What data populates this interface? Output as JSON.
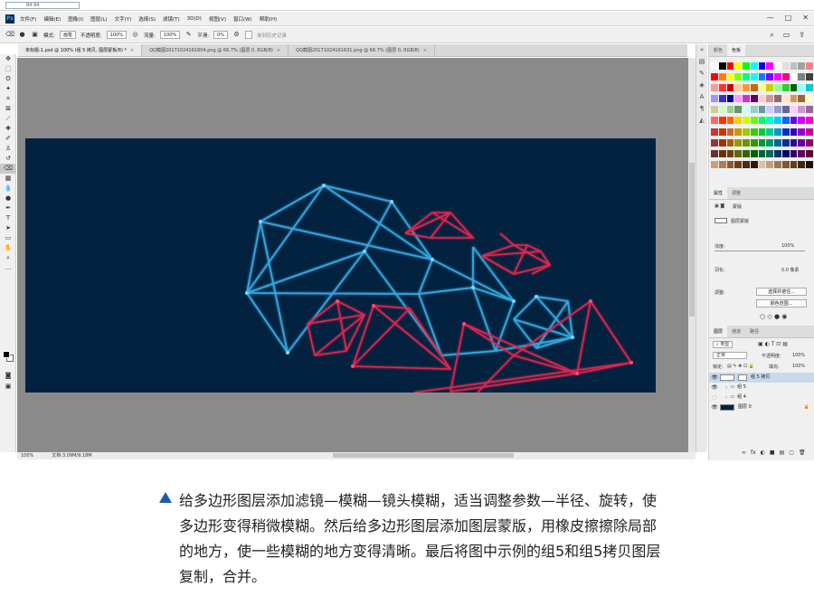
{
  "browser_strip": {
    "address_text": "84.94"
  },
  "menu": {
    "items": [
      "文件(F)",
      "编辑(E)",
      "图像(I)",
      "图层(L)",
      "文字(Y)",
      "选择(S)",
      "滤镜(T)",
      "3D(D)",
      "视图(V)",
      "窗口(W)",
      "帮助(H)"
    ],
    "window_controls": [
      "—",
      "□",
      "✕"
    ]
  },
  "options": {
    "mode_label": "模式:",
    "mode_value": "画笔",
    "opacity_label": "不透明度:",
    "opacity_value": "100%",
    "flow_label": "流量:",
    "flow_value": "100%",
    "smooth_label": "平滑:",
    "smooth_value": "0%",
    "history_label": "抹到历史记录"
  },
  "tabs": [
    {
      "label": "未标题-1.psd @ 100% (组 5 拷贝, 图层蒙板/8) *",
      "close": "×"
    },
    {
      "label": "QQ截图20171024161604.png @ 66.7% (图层 0, RGB/8)",
      "close": "×"
    },
    {
      "label": "QQ截图20171024161631.png @ 66.7% (图层 0, RGB/8)",
      "close": "×"
    }
  ],
  "status": {
    "zoom": "100%",
    "doc": "文档:3.09M/9.18M"
  },
  "swatches_panel": {
    "tabs": [
      "颜色",
      "色板"
    ],
    "colors": [
      "#ffffff",
      "#000000",
      "#ff0000",
      "#ffff00",
      "#00ff00",
      "#00ffff",
      "#0000ff",
      "#ff00ff",
      "#ffffff",
      "#e0e0e0",
      "#c0c0c0",
      "#a0a0a0",
      "#ff8080",
      "#ff0000",
      "#ff8000",
      "#ffff00",
      "#80ff00",
      "#00ff80",
      "#00ffff",
      "#0080ff",
      "#8000ff",
      "#ff00ff",
      "#ff0080",
      "#ffffff",
      "#808080",
      "#404040",
      "#ff9999",
      "#ff3333",
      "#cc0000",
      "#ffcc99",
      "#ff9933",
      "#cc6600",
      "#ffff99",
      "#cccc00",
      "#99ff99",
      "#33cc33",
      "#006600",
      "#99ffff",
      "#00cccc",
      "#9999ff",
      "#3333cc",
      "#000099",
      "#ff99ff",
      "#cc33cc",
      "#660066",
      "#ffcccc",
      "#cc9999",
      "#996666",
      "#ffe5cc",
      "#cc9966",
      "#996633",
      "#ffffcc",
      "#cccc99",
      "#ccffcc",
      "#99cc99",
      "#669966",
      "#ccffff",
      "#99cccc",
      "#669999",
      "#ccccff",
      "#9999cc",
      "#666699",
      "#ffccff",
      "#cc99cc",
      "#996699",
      "#ff6666",
      "#ff3300",
      "#ff6600",
      "#ffcc00",
      "#ccff00",
      "#66ff00",
      "#00ff66",
      "#00ffcc",
      "#00ccff",
      "#0066ff",
      "#6600ff",
      "#cc00ff",
      "#ff00cc",
      "#cc3333",
      "#cc3300",
      "#cc6633",
      "#cc9900",
      "#99cc00",
      "#33cc00",
      "#00cc33",
      "#00cc99",
      "#0099cc",
      "#0033cc",
      "#3300cc",
      "#9900cc",
      "#cc0099",
      "#993333",
      "#993300",
      "#996600",
      "#999900",
      "#669900",
      "#339900",
      "#009933",
      "#009966",
      "#006699",
      "#003399",
      "#330099",
      "#660099",
      "#990066",
      "#663333",
      "#663300",
      "#664400",
      "#666600",
      "#336600",
      "#006600",
      "#006633",
      "#006666",
      "#003366",
      "#000066",
      "#330066",
      "#660066",
      "#660033",
      "#c9a27c",
      "#b07d52",
      "#8c5a2e",
      "#6b3f1a",
      "#4a2a10",
      "#2e1a0a",
      "#d9c2a8",
      "#bfa080",
      "#a07850",
      "#805a30",
      "#604020",
      "#402810",
      "#201008"
    ]
  },
  "properties_panel": {
    "tabs": [
      "属性",
      "调整"
    ],
    "mask_label": "蒙版",
    "layer_mask_label": "图层蒙版",
    "density_label": "浓度:",
    "density_value": "100%",
    "feather_label": "羽化:",
    "feather_value": "0.0 像素",
    "adjust_label": "调整:",
    "select_subject_btn": "选择并遮住...",
    "color_range_btn": "颜色范围..."
  },
  "layers_panel": {
    "tabs": [
      "图层",
      "通道",
      "路径"
    ],
    "kind_label": "类型",
    "blend_mode": "正常",
    "opacity_label": "不透明度:",
    "opacity_value": "100%",
    "lock_label": "锁定:",
    "fill_label": "填充:",
    "fill_value": "100%",
    "layers": [
      {
        "name": "组 5 拷贝",
        "selected": true
      },
      {
        "name": "组 5",
        "selected": false
      },
      {
        "name": "组 4",
        "selected": false
      },
      {
        "name": "图层 0",
        "selected": false
      }
    ],
    "footer_icons": [
      "fx",
      "◐",
      "■",
      "▤",
      "▢",
      "🗑"
    ]
  },
  "caption": {
    "text": "给多边形图层添加滤镜—模糊—镜头模糊，适当调整参数—半径、旋转，使多边形变得稍微模糊。然后给多边形图层添加图层蒙版，用橡皮擦擦除局部的地方，使一些模糊的地方变得清晰。最后将图中示例的组5和组5拷贝图层复制，合并。"
  }
}
